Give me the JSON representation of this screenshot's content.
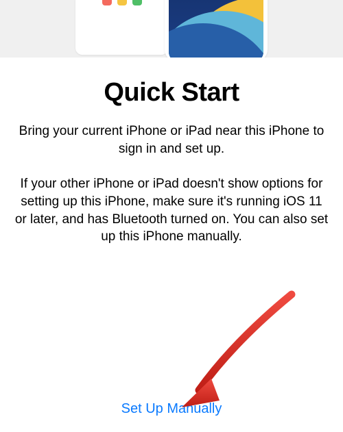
{
  "title": "Quick Start",
  "paragraph1": "Bring your current iPhone or iPad near this iPhone to sign in and set up.",
  "paragraph2": "If your other iPhone or iPad doesn't show options for setting up this iPhone, make sure it's running iOS 11 or later, and has Bluetooth turned on. You can also set up this iPhone manually.",
  "setup_manually_label": "Set Up Manually",
  "colors": {
    "link": "#0a7aff",
    "arrow": "#d1281f"
  }
}
